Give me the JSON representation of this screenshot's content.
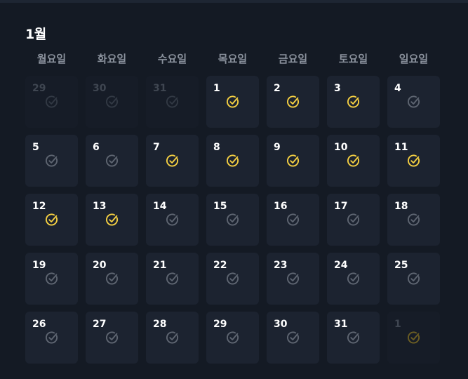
{
  "calendar": {
    "month_title": "1월",
    "weekdays": [
      "월요일",
      "화요일",
      "수요일",
      "목요일",
      "금요일",
      "토요일",
      "일요일"
    ],
    "colors": {
      "checked": "#f5d042",
      "unchecked": "#5e6571",
      "outside_unchecked": "#323944",
      "outside_checked": "#6b5d23"
    },
    "days": [
      {
        "label": "29",
        "outside": true,
        "checked": false
      },
      {
        "label": "30",
        "outside": true,
        "checked": false
      },
      {
        "label": "31",
        "outside": true,
        "checked": false
      },
      {
        "label": "1",
        "outside": false,
        "checked": true
      },
      {
        "label": "2",
        "outside": false,
        "checked": true
      },
      {
        "label": "3",
        "outside": false,
        "checked": true
      },
      {
        "label": "4",
        "outside": false,
        "checked": false
      },
      {
        "label": "5",
        "outside": false,
        "checked": false
      },
      {
        "label": "6",
        "outside": false,
        "checked": false
      },
      {
        "label": "7",
        "outside": false,
        "checked": true
      },
      {
        "label": "8",
        "outside": false,
        "checked": true
      },
      {
        "label": "9",
        "outside": false,
        "checked": true
      },
      {
        "label": "10",
        "outside": false,
        "checked": true
      },
      {
        "label": "11",
        "outside": false,
        "checked": true
      },
      {
        "label": "12",
        "outside": false,
        "checked": true
      },
      {
        "label": "13",
        "outside": false,
        "checked": true
      },
      {
        "label": "14",
        "outside": false,
        "checked": false
      },
      {
        "label": "15",
        "outside": false,
        "checked": false
      },
      {
        "label": "16",
        "outside": false,
        "checked": false
      },
      {
        "label": "17",
        "outside": false,
        "checked": false
      },
      {
        "label": "18",
        "outside": false,
        "checked": false
      },
      {
        "label": "19",
        "outside": false,
        "checked": false
      },
      {
        "label": "20",
        "outside": false,
        "checked": false
      },
      {
        "label": "21",
        "outside": false,
        "checked": false
      },
      {
        "label": "22",
        "outside": false,
        "checked": false
      },
      {
        "label": "23",
        "outside": false,
        "checked": false
      },
      {
        "label": "24",
        "outside": false,
        "checked": false
      },
      {
        "label": "25",
        "outside": false,
        "checked": false
      },
      {
        "label": "26",
        "outside": false,
        "checked": false
      },
      {
        "label": "27",
        "outside": false,
        "checked": false
      },
      {
        "label": "28",
        "outside": false,
        "checked": false
      },
      {
        "label": "29",
        "outside": false,
        "checked": false
      },
      {
        "label": "30",
        "outside": false,
        "checked": false
      },
      {
        "label": "31",
        "outside": false,
        "checked": false
      },
      {
        "label": "1",
        "outside": true,
        "checked": true
      }
    ]
  }
}
